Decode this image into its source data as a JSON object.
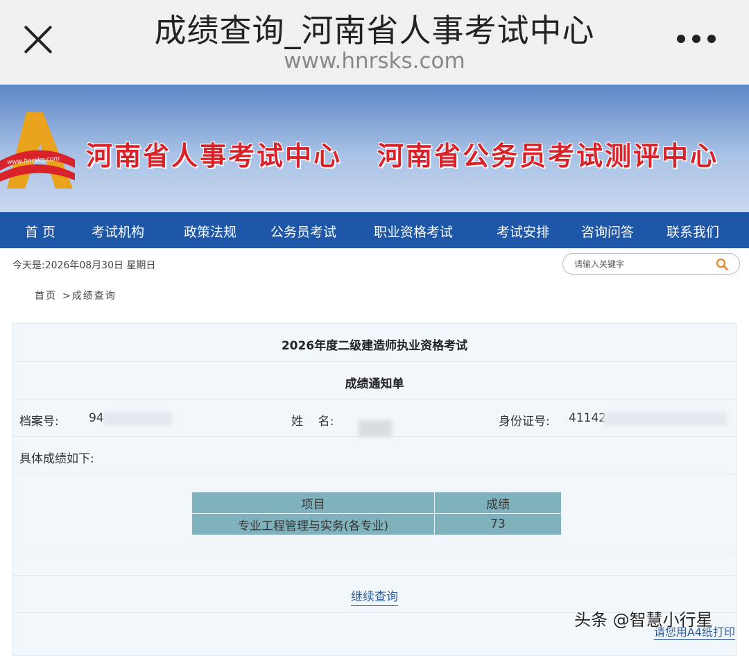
{
  "browser": {
    "title": "成绩查询_河南省人事考试中心",
    "url": "www.hnrsks.com",
    "close_icon": "close-icon",
    "more_icon": "more-dots-icon"
  },
  "banner": {
    "logo_text": "www.hnrsks.com",
    "name_left": "河南省人事考试中心",
    "name_right": "河南省公务员考试测评中心"
  },
  "nav": {
    "items": [
      "首 页",
      "考试机构",
      "政策法规",
      "公务员考试",
      "职业资格考试",
      "考试安排",
      "咨询问答",
      "联系我们"
    ]
  },
  "date_line": "今天是:2026年08月30日 星期日",
  "search": {
    "placeholder": "请输入关键字",
    "icon": "search-icon"
  },
  "breadcrumb": {
    "home": "首页",
    "current": ">成绩查询"
  },
  "notice": {
    "exam_title": "2026年度二级建造师执业资格考试",
    "doc_title": "成绩通知单",
    "file_no_label": "档案号:",
    "file_no_value": "94",
    "name_label": "姓    名:",
    "id_label": "身份证号:",
    "id_value": "41142",
    "scores_intro": "具体成绩如下:",
    "table_headers": [
      "项目",
      "成绩"
    ],
    "table_rows": [
      {
        "subject": "专业工程管理与实务(各专业)",
        "score": "73"
      }
    ],
    "continue_link": "继续查询",
    "print_note": "请您用A4纸打印"
  },
  "watermark": "头条 @智慧小行星",
  "colors": {
    "nav_bg": "#1e56a8",
    "banner_red": "#d8232a",
    "table_bg": "#7fb2bd",
    "link": "#2d5d9e"
  }
}
